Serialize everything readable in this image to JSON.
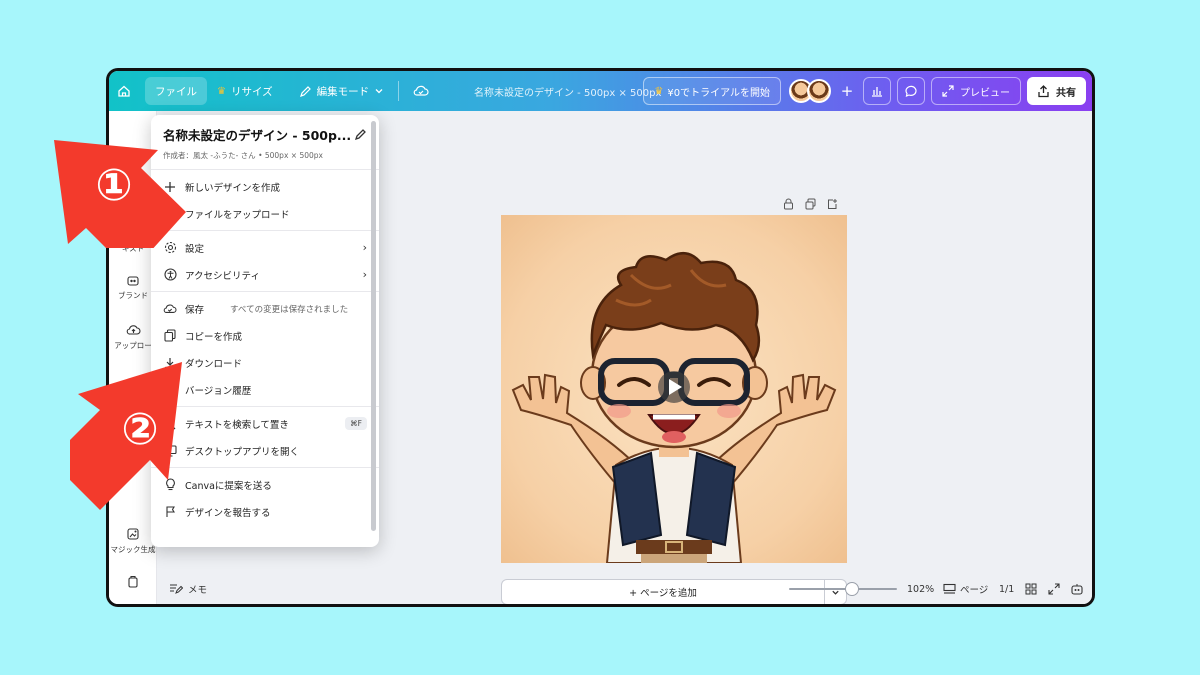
{
  "topbar": {
    "home_icon": "home-icon",
    "file_label": "ファイル",
    "resize_label": "リサイズ",
    "edit_mode_label": "編集モード",
    "doc_title": "名称未設定のデザイン - 500px × 500px",
    "trial_label": "¥0でトライアルを開始",
    "preview_label": "プレビュー",
    "share_label": "共有",
    "colors": {
      "gradient_start": "#12c2c8",
      "gradient_end": "#8a3ff0",
      "crown": "#f7c531"
    }
  },
  "rail": {
    "items": [
      {
        "label": "キスト",
        "icon": "text-icon"
      },
      {
        "label": "ブランド",
        "icon": "brand-icon"
      },
      {
        "label": "アップロー",
        "icon": "upload-cloud-icon"
      },
      {
        "label": "マジック生成",
        "icon": "magic-generate-icon"
      },
      {
        "label": "",
        "icon": "apps-icon"
      }
    ]
  },
  "menu": {
    "title": "名称未設定のデザイン - 500p...",
    "subtitle": "作成者：風太 -ふうた- さん • 500px × 500px",
    "groups": [
      [
        {
          "label": "新しいデザインを作成",
          "icon": "plus-icon"
        },
        {
          "label": "ファイルをアップロード",
          "icon": "upload-icon"
        }
      ],
      [
        {
          "label": "設定",
          "icon": "gear-icon",
          "chevron": "›"
        },
        {
          "label": "アクセシビリティ",
          "icon": "accessibility-icon",
          "chevron": "›"
        }
      ],
      [
        {
          "label": "保存",
          "icon": "cloud-check-icon",
          "note": "すべての変更は保存されました"
        },
        {
          "label": "コピーを作成",
          "icon": "copy-icon"
        },
        {
          "label": "ダウンロード",
          "icon": "download-icon"
        },
        {
          "label": "バージョン履歴",
          "icon": "history-icon"
        }
      ],
      [
        {
          "label": "テキストを検索して置き",
          "icon": "search-icon",
          "kbd": "⌘F"
        },
        {
          "label": "デスクトップアプリを開く",
          "icon": "desktop-icon"
        }
      ],
      [
        {
          "label": "Canvaに提案を送る",
          "icon": "lightbulb-icon"
        },
        {
          "label": "デザインを報告する",
          "icon": "flag-icon"
        }
      ]
    ]
  },
  "canvas": {
    "add_page_label": "+ ページを追加",
    "artwork": "cartoon boy with glasses and open arms"
  },
  "bottombar": {
    "notes_label": "メモ",
    "zoom": "102%",
    "pages_label": "ページ",
    "page_count": "1/1"
  },
  "annotations": {
    "arrow1_label": "①",
    "arrow2_label": "②",
    "arrow_color": "#f33a2c"
  }
}
